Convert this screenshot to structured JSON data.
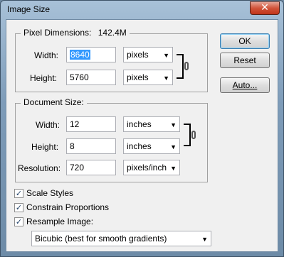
{
  "window": {
    "title": "Image Size",
    "close_glyph": "✕"
  },
  "pixel_dimensions": {
    "label": "Pixel Dimensions:",
    "size": "142.4M",
    "width": {
      "label": "Width:",
      "value": "8640",
      "unit": "pixels"
    },
    "height": {
      "label": "Height:",
      "value": "5760",
      "unit": "pixels"
    }
  },
  "document_size": {
    "label": "Document Size:",
    "width": {
      "label": "Width:",
      "value": "12",
      "unit": "inches"
    },
    "height": {
      "label": "Height:",
      "value": "8",
      "unit": "inches"
    },
    "resolution": {
      "label": "Resolution:",
      "value": "720",
      "unit": "pixels/inch"
    }
  },
  "options": {
    "scale_styles": {
      "label": "Scale Styles",
      "checked": true
    },
    "constrain_proportions": {
      "label": "Constrain Proportions",
      "checked": true
    },
    "resample_image": {
      "label": "Resample Image:",
      "checked": true
    },
    "resample_method": "Bicubic (best for smooth gradients)"
  },
  "buttons": {
    "ok": "OK",
    "reset": "Reset",
    "auto": "Auto..."
  },
  "icons": {
    "dropdown": "▼",
    "check": "✓",
    "link": "chain-link-icon"
  }
}
